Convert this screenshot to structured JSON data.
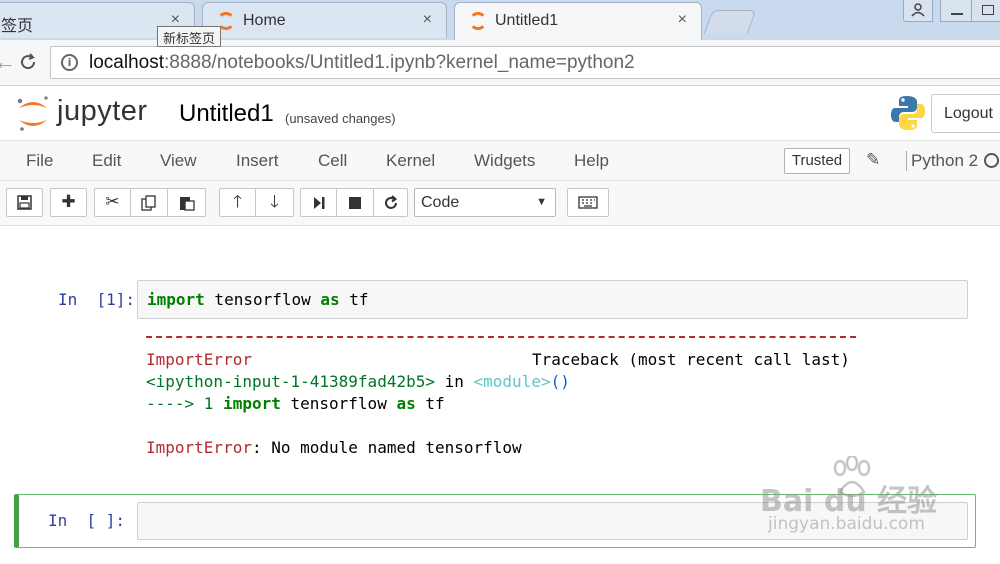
{
  "browser": {
    "tabs": [
      {
        "title": "签页",
        "active": false
      },
      {
        "title": "Home",
        "active": false
      },
      {
        "title": "Untitled1",
        "active": true
      }
    ],
    "tab_close_glyph": "×",
    "tooltip": "新标签页",
    "url": {
      "host": "localhost",
      "rest": ":8888/notebooks/Untitled1.ipynb?kernel_name=python2"
    }
  },
  "header": {
    "logo_text": "jupyter",
    "notebook_name": "Untitled1",
    "save_status": "(unsaved changes)",
    "logout_label": "Logout"
  },
  "menubar": {
    "items": [
      "File",
      "Edit",
      "View",
      "Insert",
      "Cell",
      "Kernel",
      "Widgets",
      "Help"
    ],
    "trusted_label": "Trusted",
    "kernel_name": "Python 2"
  },
  "toolbar": {
    "icons": [
      "save-icon",
      "plus-icon",
      "cut-icon",
      "copy-icon",
      "paste-icon",
      "arrow-up-icon",
      "arrow-down-icon",
      "run-icon",
      "stop-icon",
      "restart-icon",
      "keyboard-icon"
    ],
    "cell_type": "Code"
  },
  "cells": [
    {
      "prompt": "In  [1]:",
      "code": {
        "kw1": "import",
        "mid": " tensorflow ",
        "kw2": "as",
        "end": " tf"
      },
      "output": {
        "error_name": "ImportError",
        "traceback_label": "Traceback (most recent call last)",
        "input_ref": "<ipython-input-1-41389fad42b5>",
        "in_word": " in ",
        "module_ref": "<module>",
        "call_parens": "()",
        "arrow_line": "----> 1 ",
        "arrow_kw1": "import",
        "arrow_mid": " tensorflow ",
        "arrow_kw2": "as",
        "arrow_end": " tf",
        "final_error_name": "ImportError",
        "final_error_msg": ": No module named tensorflow"
      }
    },
    {
      "prompt": "In  [ ]:",
      "code": ""
    }
  ],
  "watermark": {
    "brand": "Bai du 经验",
    "domain": "jingyan.baidu.com"
  },
  "colors": {
    "jupyter_orange": "#f37726",
    "error_red": "#b22b31",
    "keyword_green": "#008000",
    "prompt_blue": "#303f9f",
    "selected_green": "#42a045"
  }
}
